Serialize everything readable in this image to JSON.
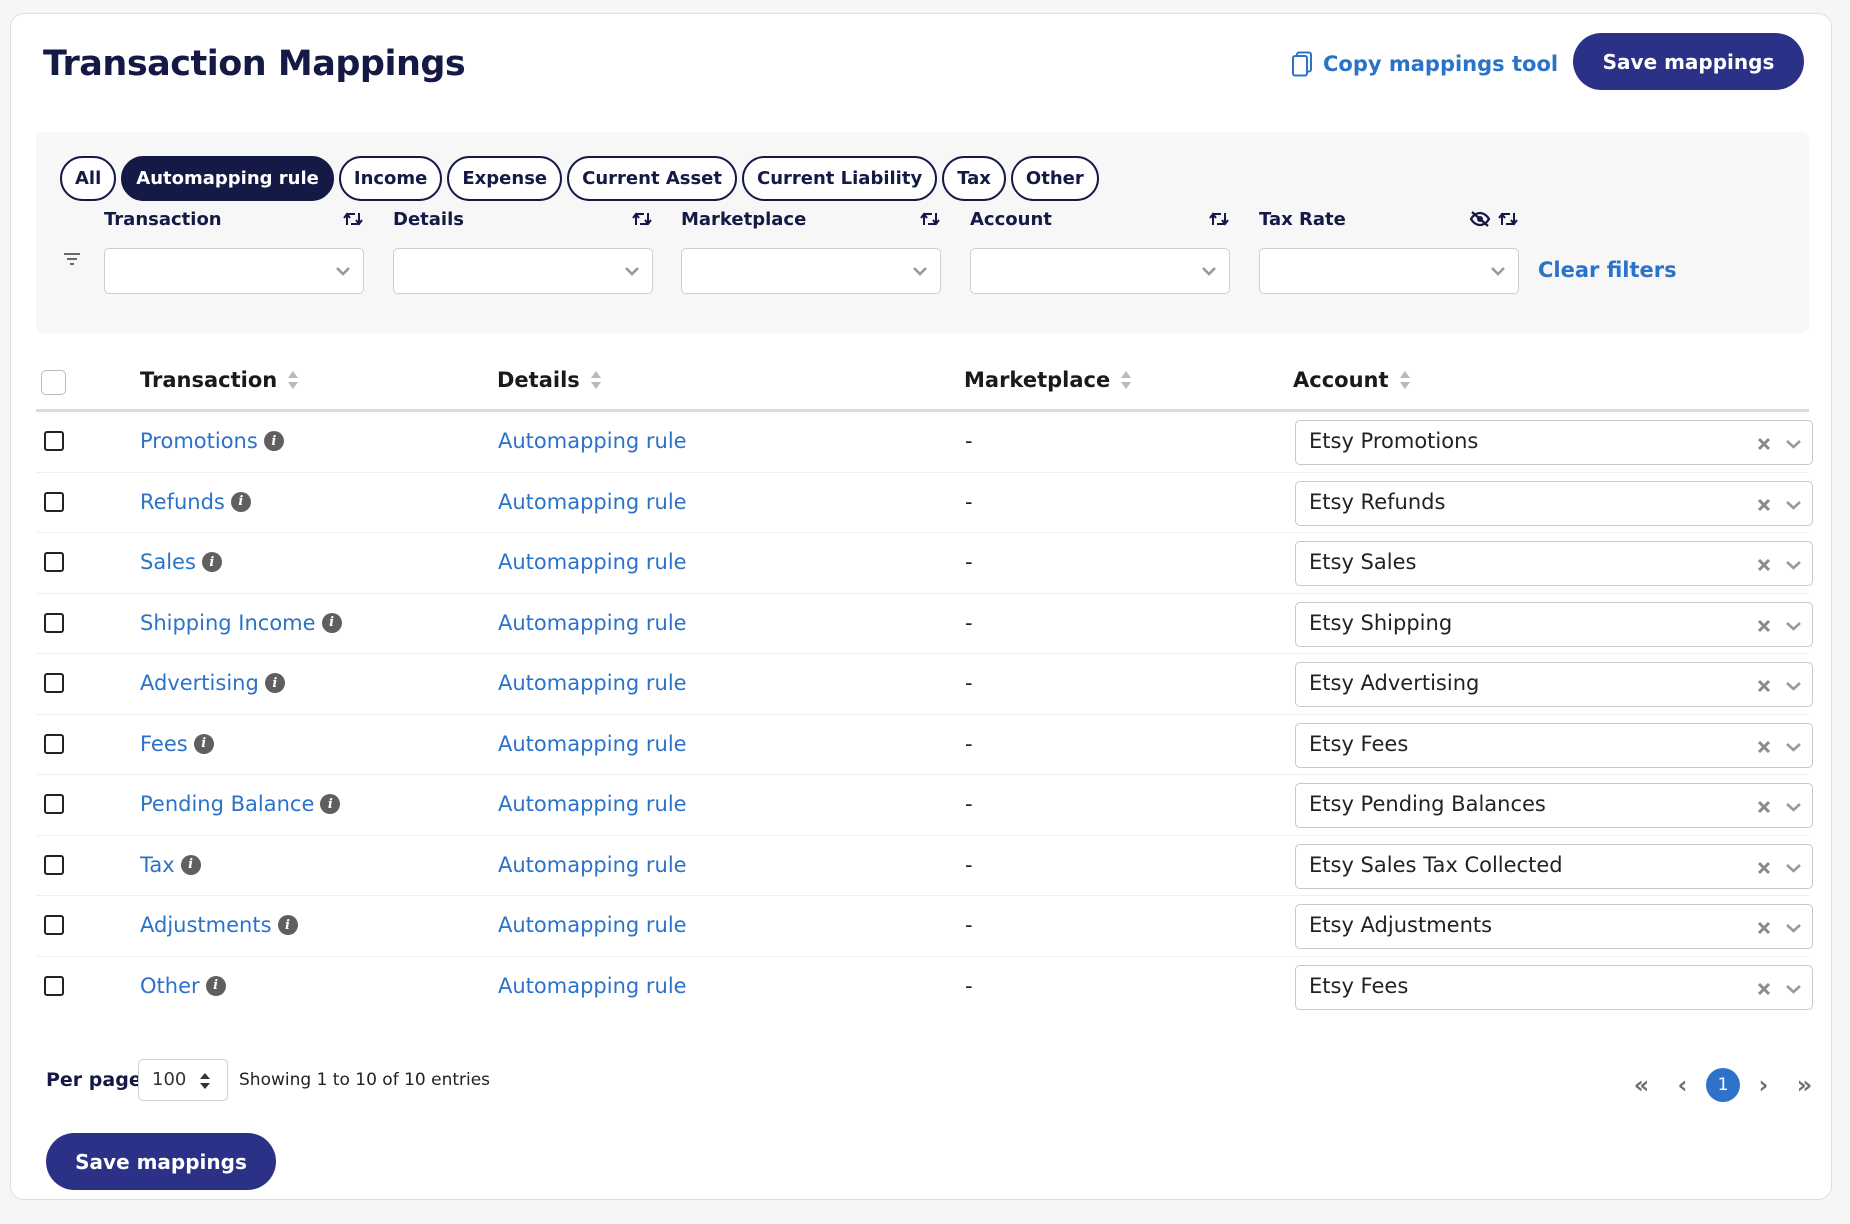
{
  "header": {
    "title": "Transaction Mappings",
    "copy_tool_label": "Copy mappings tool",
    "save_label": "Save mappings"
  },
  "colors": {
    "primary": "#2b3186",
    "title": "#141a45",
    "link": "#2b72c9",
    "page_active": "#2f72c9"
  },
  "filter_pills": [
    {
      "label": "All",
      "active": false
    },
    {
      "label": "Automapping rule",
      "active": true
    },
    {
      "label": "Income",
      "active": false
    },
    {
      "label": "Expense",
      "active": false
    },
    {
      "label": "Current Asset",
      "active": false
    },
    {
      "label": "Current Liability",
      "active": false
    },
    {
      "label": "Tax",
      "active": false
    },
    {
      "label": "Other",
      "active": false
    }
  ],
  "filters": {
    "columns": [
      {
        "label": "Transaction",
        "value": "",
        "icons": [
          "sort-swap-icon"
        ]
      },
      {
        "label": "Details",
        "value": "",
        "icons": [
          "sort-swap-icon"
        ]
      },
      {
        "label": "Marketplace",
        "value": "",
        "icons": [
          "sort-swap-icon"
        ]
      },
      {
        "label": "Account",
        "value": "",
        "icons": [
          "sort-swap-icon"
        ]
      },
      {
        "label": "Tax Rate",
        "value": "",
        "icons": [
          "eye-slash-icon",
          "sort-swap-icon"
        ]
      }
    ],
    "clear_label": "Clear filters"
  },
  "table": {
    "headers": [
      "Transaction",
      "Details",
      "Marketplace",
      "Account"
    ],
    "rows": [
      {
        "transaction": "Promotions",
        "details": "Automapping rule",
        "marketplace": "-",
        "account": "Etsy Promotions",
        "checked": false
      },
      {
        "transaction": "Refunds",
        "details": "Automapping rule",
        "marketplace": "-",
        "account": "Etsy Refunds",
        "checked": false
      },
      {
        "transaction": "Sales",
        "details": "Automapping rule",
        "marketplace": "-",
        "account": "Etsy Sales",
        "checked": false
      },
      {
        "transaction": "Shipping Income",
        "details": "Automapping rule",
        "marketplace": "-",
        "account": "Etsy Shipping",
        "checked": false
      },
      {
        "transaction": "Advertising",
        "details": "Automapping rule",
        "marketplace": "-",
        "account": "Etsy Advertising",
        "checked": false
      },
      {
        "transaction": "Fees",
        "details": "Automapping rule",
        "marketplace": "-",
        "account": "Etsy Fees",
        "checked": false
      },
      {
        "transaction": "Pending Balance",
        "details": "Automapping rule",
        "marketplace": "-",
        "account": "Etsy Pending Balances",
        "checked": false
      },
      {
        "transaction": "Tax",
        "details": "Automapping rule",
        "marketplace": "-",
        "account": "Etsy Sales Tax Collected",
        "checked": false
      },
      {
        "transaction": "Adjustments",
        "details": "Automapping rule",
        "marketplace": "-",
        "account": "Etsy Adjustments",
        "checked": false
      },
      {
        "transaction": "Other",
        "details": "Automapping rule",
        "marketplace": "-",
        "account": "Etsy Fees",
        "checked": false
      }
    ]
  },
  "footer": {
    "per_page_label": "Per page",
    "per_page_value": "100",
    "showing_text": "Showing 1 to 10 of 10 entries",
    "pagination": {
      "first": "«",
      "prev": "‹",
      "current": "1",
      "next": "›",
      "last": "»"
    },
    "save_label": "Save mappings"
  }
}
